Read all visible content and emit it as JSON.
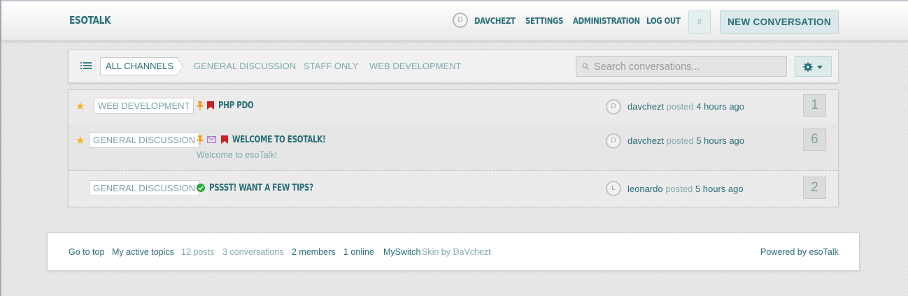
{
  "header": {
    "brand": "ESOTALK",
    "user_avatar": "D",
    "username": "DAVCHEZT",
    "settings": "SETTINGS",
    "administration": "ADMINISTRATION",
    "logout": "LOG OUT",
    "notifications_count": "0",
    "new_conversation": "NEW CONVERSATION"
  },
  "channels": {
    "list_icon": "list-icon",
    "all": "ALL CHANNELS",
    "items": [
      "GENERAL DISCUSSION",
      "STAFF ONLY",
      "WEB DEVELOPMENT"
    ]
  },
  "search": {
    "placeholder": "Search conversations..."
  },
  "settings_menu": {
    "icon": "gear-icon"
  },
  "conversations": [
    {
      "starred": true,
      "channel": "WEB DEVELOPMENT",
      "icons": [
        "pin-icon",
        "bookmark-icon"
      ],
      "title": "PHP PDO",
      "excerpt": "",
      "avatar": "D",
      "user": "davchezt",
      "posted": "posted",
      "time": "4 hours ago",
      "replies": "1"
    },
    {
      "starred": true,
      "channel": "GENERAL DISCUSSION",
      "icons": [
        "pin-icon",
        "envelope-icon",
        "bookmark-icon"
      ],
      "title": "WELCOME TO ESOTALK!",
      "excerpt": "Welcome to esoTalk!",
      "avatar": "D",
      "user": "davchezt",
      "posted": "posted",
      "time": "5 hours ago",
      "replies": "6"
    },
    {
      "starred": false,
      "channel": "GENERAL DISCUSSION",
      "icons": [
        "check-circle-icon"
      ],
      "title": "PSSST! WANT A FEW TIPS?",
      "excerpt": "",
      "avatar": "L",
      "user": "leonardo",
      "posted": "posted",
      "time": "5 hours ago",
      "replies": "2"
    }
  ],
  "footer": {
    "go_to_top": "Go to top",
    "my_active_topics": "My active topics",
    "posts": "12 posts",
    "conversations": "3 conversations",
    "members": "2 members",
    "online": "1 online",
    "skin_name": "MySwitch",
    "skin_by": "Skin by DaVchezt",
    "powered_by": "Powered by esoTalk"
  },
  "colors": {
    "accent": "#2b6e78",
    "muted": "#84a9ae",
    "star": "#f3b31c",
    "pin": "#f0a020",
    "bookmark": "#cc1f1f",
    "envelope": "#b07ac4",
    "check": "#2aa83a"
  }
}
